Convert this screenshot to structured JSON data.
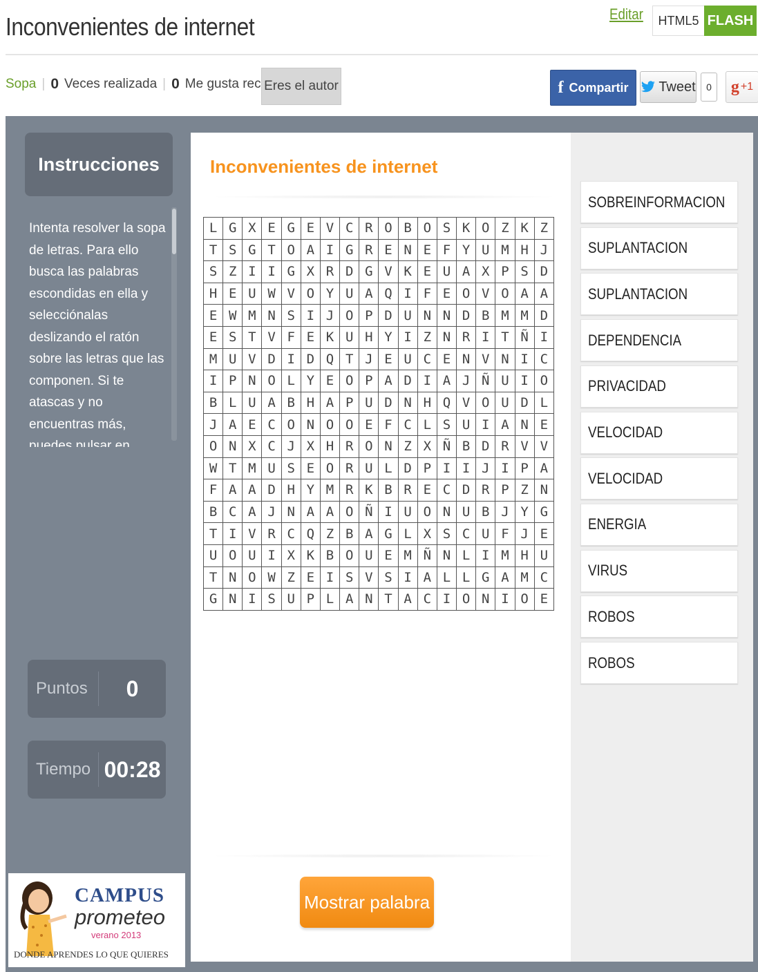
{
  "header": {
    "title": "Inconvenientes de internet",
    "edit_label": "Editar",
    "mode_html5": "HTML5",
    "mode_flash": "FLASH"
  },
  "stats": {
    "type": "Sopa",
    "plays_count": "0",
    "plays_label": "Veces realizada",
    "likes_count": "0",
    "likes_label": "Me gusta recibidos",
    "author_button": "Eres el autor"
  },
  "social": {
    "facebook_label": "Compartir",
    "tweet_label": "Tweet",
    "tweet_count": "0",
    "gplus_label": "+1"
  },
  "sidebar": {
    "instructions_title": "Instrucciones",
    "instructions_text": "Intenta resolver la sopa de letras. Para ello busca las palabras escondidas en ella y selecciónalas deslizando el ratón sobre las letras que las componen. Si te atascas y no encuentras más, puedes pulsar en Mostrar Palabra para que te diga una palabra que buscar si",
    "points_label": "Puntos",
    "points_value": "0",
    "time_label": "Tiempo",
    "time_value": "00:28"
  },
  "logo": {
    "campus": "CAMPUS",
    "prometeo": "prometeo",
    "verano": "verano 2013",
    "slogan": "DONDE APRENDES LO QUE QUIERES"
  },
  "game": {
    "title": "Inconvenientes de internet",
    "show_word_button": "Mostrar palabra",
    "grid": [
      [
        "L",
        "G",
        "X",
        "E",
        "G",
        "E",
        "V",
        "C",
        "R",
        "O",
        "B",
        "O",
        "S",
        "K",
        "O",
        "Z",
        "K",
        "Z"
      ],
      [
        "T",
        "S",
        "G",
        "T",
        "O",
        "A",
        "I",
        "G",
        "R",
        "E",
        "N",
        "E",
        "F",
        "Y",
        "U",
        "M",
        "H",
        "J"
      ],
      [
        "S",
        "Z",
        "I",
        "I",
        "G",
        "X",
        "R",
        "D",
        "G",
        "V",
        "K",
        "E",
        "U",
        "A",
        "X",
        "P",
        "S",
        "D"
      ],
      [
        "H",
        "E",
        "U",
        "W",
        "V",
        "O",
        "Y",
        "U",
        "A",
        "Q",
        "I",
        "F",
        "E",
        "O",
        "V",
        "O",
        "A",
        "A"
      ],
      [
        "E",
        "W",
        "M",
        "N",
        "S",
        "I",
        "J",
        "O",
        "P",
        "D",
        "U",
        "N",
        "N",
        "D",
        "B",
        "M",
        "M",
        "D"
      ],
      [
        "E",
        "S",
        "T",
        "V",
        "F",
        "E",
        "K",
        "U",
        "H",
        "Y",
        "I",
        "Z",
        "N",
        "R",
        "I",
        "T",
        "Ñ",
        "I"
      ],
      [
        "M",
        "U",
        "V",
        "D",
        "I",
        "D",
        "Q",
        "T",
        "J",
        "E",
        "U",
        "C",
        "E",
        "N",
        "V",
        "N",
        "I",
        "C"
      ],
      [
        "I",
        "P",
        "N",
        "O",
        "L",
        "Y",
        "E",
        "O",
        "P",
        "A",
        "D",
        "I",
        "A",
        "J",
        "Ñ",
        "U",
        "I",
        "O"
      ],
      [
        "B",
        "L",
        "U",
        "A",
        "B",
        "H",
        "A",
        "P",
        "U",
        "D",
        "N",
        "H",
        "Q",
        "V",
        "O",
        "U",
        "D",
        "L"
      ],
      [
        "J",
        "A",
        "E",
        "C",
        "O",
        "N",
        "O",
        "O",
        "E",
        "F",
        "C",
        "L",
        "S",
        "U",
        "I",
        "A",
        "N",
        "E"
      ],
      [
        "O",
        "N",
        "X",
        "C",
        "J",
        "X",
        "H",
        "R",
        "O",
        "N",
        "Z",
        "X",
        "Ñ",
        "B",
        "D",
        "R",
        "V",
        "V"
      ],
      [
        "W",
        "T",
        "M",
        "U",
        "S",
        "E",
        "O",
        "R",
        "U",
        "L",
        "D",
        "P",
        "I",
        "I",
        "J",
        "I",
        "P",
        "A"
      ],
      [
        "F",
        "A",
        "A",
        "D",
        "H",
        "Y",
        "M",
        "R",
        "K",
        "B",
        "R",
        "E",
        "C",
        "D",
        "R",
        "P",
        "Z",
        "N"
      ],
      [
        "B",
        "C",
        "A",
        "J",
        "N",
        "A",
        "A",
        "O",
        "Ñ",
        "I",
        "U",
        "O",
        "N",
        "U",
        "B",
        "J",
        "Y",
        "G"
      ],
      [
        "T",
        "I",
        "V",
        "R",
        "C",
        "Q",
        "Z",
        "B",
        "A",
        "G",
        "L",
        "X",
        "S",
        "C",
        "U",
        "F",
        "J",
        "E"
      ],
      [
        "U",
        "O",
        "U",
        "I",
        "X",
        "K",
        "B",
        "O",
        "U",
        "E",
        "M",
        "Ñ",
        "N",
        "L",
        "I",
        "M",
        "H",
        "U"
      ],
      [
        "T",
        "N",
        "O",
        "W",
        "Z",
        "E",
        "I",
        "S",
        "V",
        "S",
        "I",
        "A",
        "L",
        "L",
        "G",
        "A",
        "M",
        "C"
      ],
      [
        "G",
        "N",
        "I",
        "S",
        "U",
        "P",
        "L",
        "A",
        "N",
        "T",
        "A",
        "C",
        "I",
        "O",
        "N",
        "I",
        "O",
        "E"
      ]
    ],
    "words": [
      "SOBREINFORMACION",
      "SUPLANTACION",
      "SUPLANTACION",
      "DEPENDENCIA",
      "PRIVACIDAD",
      "VELOCIDAD",
      "VELOCIDAD",
      "ENERGIA",
      "VIRUS",
      "ROBOS",
      "ROBOS"
    ]
  }
}
